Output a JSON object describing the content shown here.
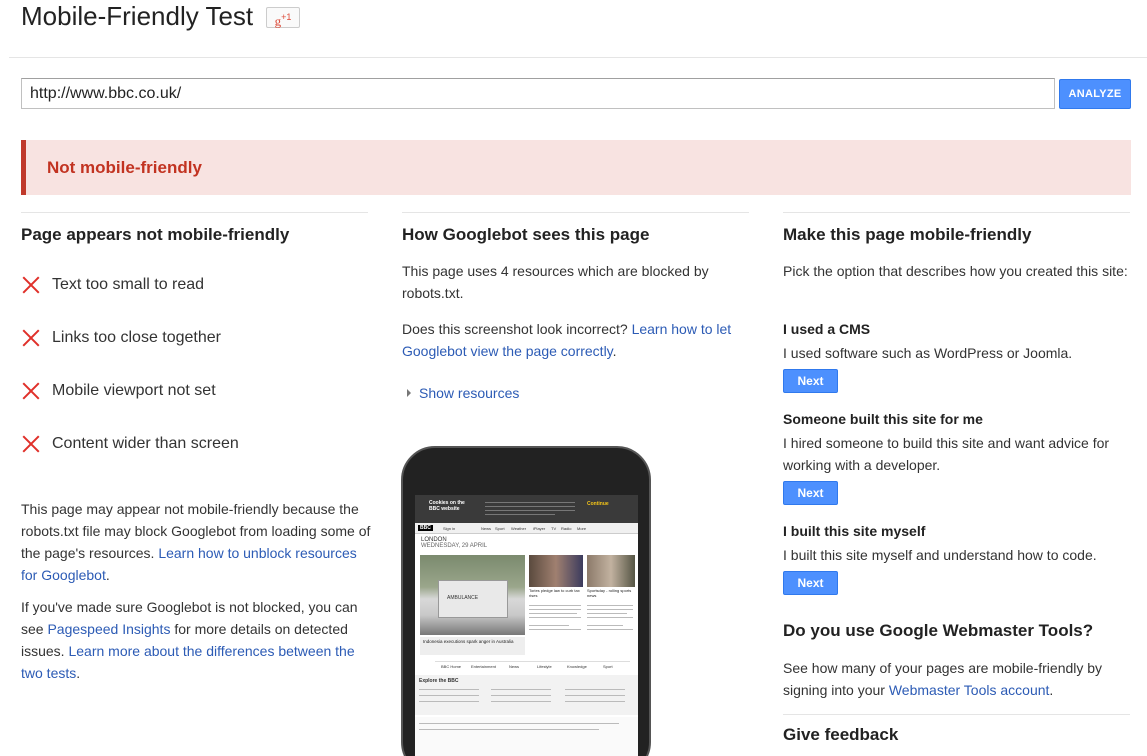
{
  "header": {
    "title": "Mobile-Friendly Test",
    "gplus_label": "g",
    "gplus_sup": "+1"
  },
  "search": {
    "url_value": "http://www.bbc.co.uk/",
    "analyze_label": "ANALYZE"
  },
  "result": {
    "banner_text": "Not mobile-friendly",
    "banner_color": "#c23321"
  },
  "left_col": {
    "heading": "Page appears not mobile-friendly",
    "issues": [
      "Text too small to read",
      "Links too close together",
      "Mobile viewport not set",
      "Content wider than screen"
    ],
    "para1_text": "This page may appear not mobile-friendly because the robots.txt file may block Googlebot from loading some of the page's resources.",
    "para1_link": "Learn how to unblock resources for Googlebot",
    "para2_text": "If you've made sure Googlebot is not blocked, you can see",
    "para2_link1": "Pagespeed Insights",
    "para2_mid": "for more details on detected issues.",
    "para2_link2": "Learn more about the differences between the two tests"
  },
  "mid_col": {
    "heading": "How Googlebot sees this page",
    "resources_text": "This page uses 4 resources which are blocked by robots.txt.",
    "incorrect_text": "Does this screenshot look incorrect?",
    "incorrect_link": "Learn how to let Googlebot view the page correctly",
    "show_resources": "Show resources",
    "preview": {
      "cookie_title": "Cookies on the BBC website",
      "cookie_continue": "Continue",
      "bbc_logo": "BBC",
      "nav": [
        "Sign in",
        "News",
        "Sport",
        "Weather",
        "iPlayer",
        "TV",
        "Radio",
        "More"
      ],
      "city": "LONDON",
      "date": "WEDNESDAY, 29 APRIL",
      "van_text": "AMBULANCE",
      "caption_main": "Indonesia executions spark anger in Australia",
      "caption_b": "Tories pledge law to curb tax rises",
      "caption_c": "Sportsday - rolling sports news",
      "tabs": [
        "BBC Home",
        "Entertainment",
        "News",
        "Lifestyle",
        "Knowledge",
        "Sport"
      ],
      "explore_title": "Explore the BBC"
    }
  },
  "right_col": {
    "heading": "Make this page mobile-friendly",
    "intro": "Pick the option that describes how you created this site:",
    "options": [
      {
        "title": "I used a CMS",
        "desc": "I used software such as WordPress or Joomla.",
        "button": "Next"
      },
      {
        "title": "Someone built this site for me",
        "desc": "I hired someone to build this site and want advice for working with a developer.",
        "button": "Next"
      },
      {
        "title": "I built this site myself",
        "desc": "I built this site myself and understand how to code.",
        "button": "Next"
      }
    ],
    "wmt_heading": "Do you use Google Webmaster Tools?",
    "wmt_text": "See how many of your pages are mobile-friendly by signing into your",
    "wmt_link": "Webmaster Tools account",
    "feedback_heading": "Give feedback"
  },
  "colors": {
    "accent_blue": "#4d90fe",
    "link_blue": "#2c5bb5",
    "error_red": "#e0302a",
    "banner_bg": "#f8e3e1"
  }
}
